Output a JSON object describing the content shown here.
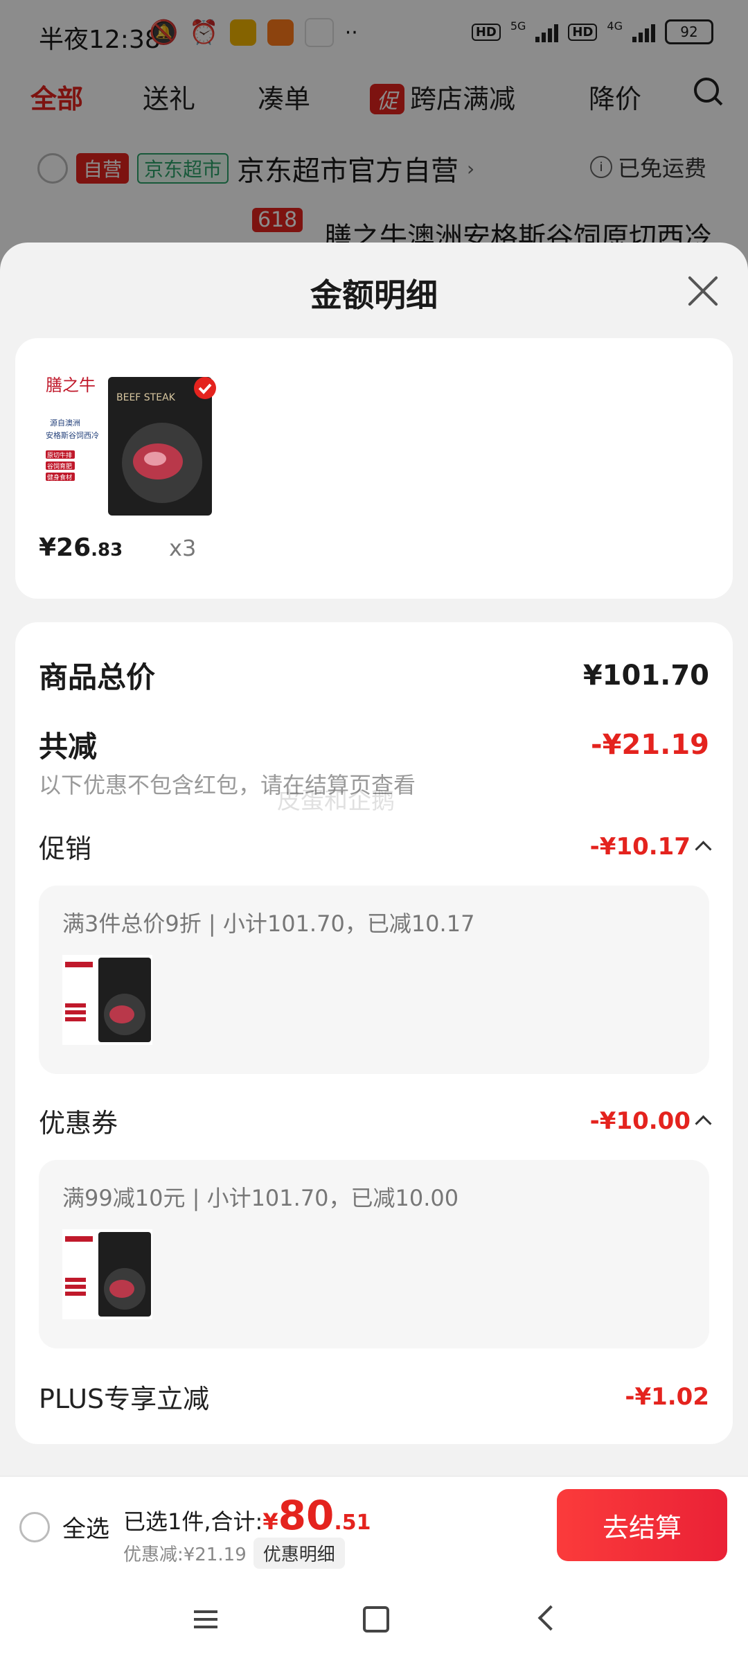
{
  "status_bar": {
    "time": "半夜12:38",
    "battery": "92",
    "net1": "5G",
    "net2": "4G",
    "hd": "HD"
  },
  "top_tabs": {
    "all": "全部",
    "gift": "送礼",
    "combine": "凑单",
    "promo_badge": "促",
    "cross_store": "跨店满减",
    "price_drop": "降价"
  },
  "store": {
    "tag_self": "自营",
    "tag_supermarket": "京东超市",
    "name": "京东超市官方自营",
    "shipping": "已免运费",
    "badge": "618",
    "product_title": "膳之牛澳洲安格斯谷饲原切西冷牛"
  },
  "sheet": {
    "title": "金额明细",
    "product": {
      "price_int": "¥26",
      "price_dec": ".83",
      "qty": "x3",
      "brand": "膳之牛",
      "origin": "源自澳洲",
      "name": "安格斯谷饲西冷",
      "tags": [
        "原切牛排",
        "谷饲育肥",
        "健身食材"
      ],
      "pack_label": "BEEF STEAK"
    },
    "goods_total_label": "商品总价",
    "goods_total_value": "¥101.70",
    "total_discount_label": "共减",
    "total_discount_value": "-¥21.19",
    "discount_note": "以下优惠不包含红包，请在结算页查看",
    "promo_label": "促销",
    "promo_value": "-¥10.17",
    "promo_detail": "满3件总价9折 | 小计101.70，已减10.17",
    "coupon_label": "优惠券",
    "coupon_value": "-¥10.00",
    "coupon_detail": "满99减10元 | 小计101.70，已减10.00",
    "plus_label": "PLUS专享立减",
    "plus_value": "-¥1.02",
    "watermark": "皮蛋和企鹅"
  },
  "bottom": {
    "select_all": "全选",
    "selected_prefix": "已选1件,合计:",
    "yen": "¥",
    "total_int": "80",
    "total_dec": ".51",
    "discount_text": "优惠减:¥21.19",
    "detail_button": "优惠明细",
    "checkout": "去结算"
  },
  "colors": {
    "accent": "#e4231e",
    "green_tag": "#2ca36a"
  }
}
